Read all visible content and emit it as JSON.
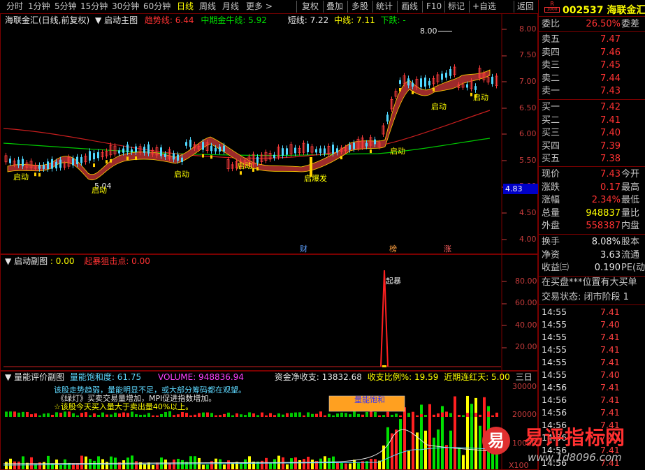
{
  "toolbar": {
    "periods": [
      "分时",
      "1分钟",
      "5分钟",
      "15分钟",
      "30分钟",
      "60分钟",
      "日线",
      "周线",
      "月线",
      "更多 >"
    ],
    "active_period": "日线",
    "actions": [
      "复权",
      "叠加",
      "多股",
      "统计",
      "画线",
      "F10",
      "标记",
      "+自选",
      "返回"
    ]
  },
  "main_chart": {
    "title": "海联金汇(日线,前复权)",
    "indicator": "启动主图",
    "legend": [
      {
        "text": "趋势线: 6.44",
        "color": "#ff3232"
      },
      {
        "text": "中期金牛线: 5.92",
        "color": "#00e000"
      },
      {
        "text": "短线: 7.22",
        "color": "#e6e6e6"
      },
      {
        "text": "中线: 7.11",
        "color": "#ffff00"
      },
      {
        "text": "下跌: -",
        "color": "#00e000"
      }
    ],
    "y_axis": [
      "8.00",
      "7.50",
      "7.00",
      "6.50",
      "6.00",
      "5.50",
      "5.00",
      "4.50",
      "4.00"
    ],
    "price_tag": "4.83",
    "high_label": "8.00",
    "low_label": "5.04",
    "signals": [
      "启动",
      "启动",
      "启动",
      "启动",
      "启动",
      "启动",
      "启动",
      "启动"
    ],
    "burst_label": "启爆发",
    "events": [
      "财",
      "榜",
      "涨"
    ]
  },
  "sub_chart": {
    "indicator": "启动副图",
    "value": ": 0.00",
    "label2": "起暴狙击点: 0.00",
    "spike_label": "起暴",
    "y_axis": [
      "80.00",
      "60.00",
      "40.00",
      "20.00"
    ]
  },
  "vol_chart": {
    "indicator": "量能评价副图",
    "item1": "量能饱和度: 61.75",
    "volume": "VOLUME: 948836.94",
    "fund": "资金净收支: 13832.68",
    "ratio": "收支比例%: 19.59",
    "streak": "近期连红天: 5.00",
    "extra": "三日",
    "comments": [
      "该股走势趋弱，量能明显不足，或大部分筹码都在观望。",
      "《绿灯》买卖交易量增加，MPI促进指数增加。",
      "☆该股今天买入量大于卖出量40%以上。"
    ],
    "box_label": "量能饱和",
    "y_axis": [
      "30000",
      "20000",
      "10000",
      "X100"
    ]
  },
  "quote": {
    "badge": "R",
    "code": "002537",
    "name": "海联金汇",
    "weibi_label": "委比",
    "weibi": "26.50%",
    "weicha": "委差",
    "asks": [
      {
        "label": "卖五",
        "price": "7.47"
      },
      {
        "label": "卖四",
        "price": "7.46"
      },
      {
        "label": "卖三",
        "price": "7.45"
      },
      {
        "label": "卖二",
        "price": "7.44"
      },
      {
        "label": "卖一",
        "price": "7.43"
      }
    ],
    "bids": [
      {
        "label": "买一",
        "price": "7.42"
      },
      {
        "label": "买二",
        "price": "7.41"
      },
      {
        "label": "买三",
        "price": "7.40"
      },
      {
        "label": "买四",
        "price": "7.39"
      },
      {
        "label": "买五",
        "price": "7.38"
      }
    ],
    "stats": [
      {
        "k": "现价",
        "v": "7.43",
        "t": "今开",
        "c": "#ff3232"
      },
      {
        "k": "涨跌",
        "v": "0.17",
        "t": "最高",
        "c": "#ff3232"
      },
      {
        "k": "涨幅",
        "v": "2.34%",
        "t": "最低",
        "c": "#ff3232"
      },
      {
        "k": "总量",
        "v": "948837",
        "t": "量比",
        "c": "#ffff00"
      },
      {
        "k": "外盘",
        "v": "558387",
        "t": "内盘",
        "c": "#ff3232"
      },
      {
        "k": "换手",
        "v": "8.08%",
        "t": "股本",
        "c": "#e6e6e6"
      },
      {
        "k": "净资",
        "v": "3.63",
        "t": "流通",
        "c": "#e6e6e6"
      },
      {
        "k": "收益㈢",
        "v": "0.190",
        "t": "PE(动",
        "c": "#e6e6e6"
      }
    ],
    "note1": "在买盘***位置有大买单",
    "note2": "交易状态: 闭市阶段 1",
    "ticks": [
      {
        "time": "14:55",
        "price": "7.41"
      },
      {
        "time": "14:55",
        "price": "7.40"
      },
      {
        "time": "14:55",
        "price": "7.41"
      },
      {
        "time": "14:55",
        "price": "7.41"
      },
      {
        "time": "14:55",
        "price": "7.41"
      },
      {
        "time": "14:55",
        "price": "7.40"
      },
      {
        "time": "14:56",
        "price": "7.41"
      },
      {
        "time": "14:56",
        "price": "7.41"
      },
      {
        "time": "14:56",
        "price": "7.41"
      },
      {
        "time": "14:56",
        "price": "7.41"
      },
      {
        "time": "14:56",
        "price": "7.41"
      },
      {
        "time": "14:56",
        "price": "7.41"
      },
      {
        "time": "14:56",
        "price": "7.41"
      }
    ]
  },
  "watermark": {
    "logo_char": "易",
    "brand": "易评指标网",
    "url": "www.1d8096.com"
  }
}
